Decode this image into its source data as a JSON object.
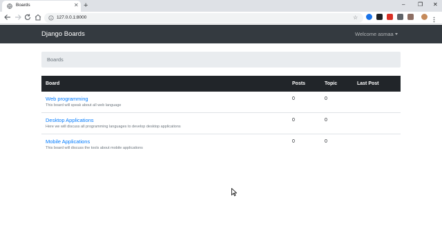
{
  "browser": {
    "tab_title": "Boards",
    "tab_close": "✕",
    "new_tab": "+",
    "url": "127.0.0.1:8000",
    "window_controls": [
      "–",
      "❐",
      "✕"
    ]
  },
  "navbar": {
    "brand": "Django Boards",
    "user_menu": "Welcome asmaa"
  },
  "breadcrumb": {
    "active": "Boards"
  },
  "table": {
    "headers": [
      "Board",
      "Posts",
      "Topic",
      "Last Post"
    ],
    "rows": [
      {
        "name": "Web programming",
        "description": "This board will speak about all web language",
        "posts": "0",
        "topics": "0",
        "last_post": ""
      },
      {
        "name": "Desktop Applications",
        "description": "Here we will discuss all programming languages to develop desktop applications",
        "posts": "0",
        "topics": "0",
        "last_post": ""
      },
      {
        "name": "Mobile Applications",
        "description": "This board will discuss the tools about mobile applications",
        "posts": "0",
        "topics": "0",
        "last_post": ""
      }
    ]
  },
  "colors": {
    "navbar_bg": "#343a40",
    "table_head_bg": "#212529",
    "link": "#007bff",
    "breadcrumb_bg": "#e9ecef"
  },
  "icons": [
    "globe-icon",
    "back-arrow-icon",
    "forward-arrow-icon",
    "reload-icon",
    "home-icon",
    "info-icon",
    "star-icon",
    "mouse-cursor-icon"
  ]
}
